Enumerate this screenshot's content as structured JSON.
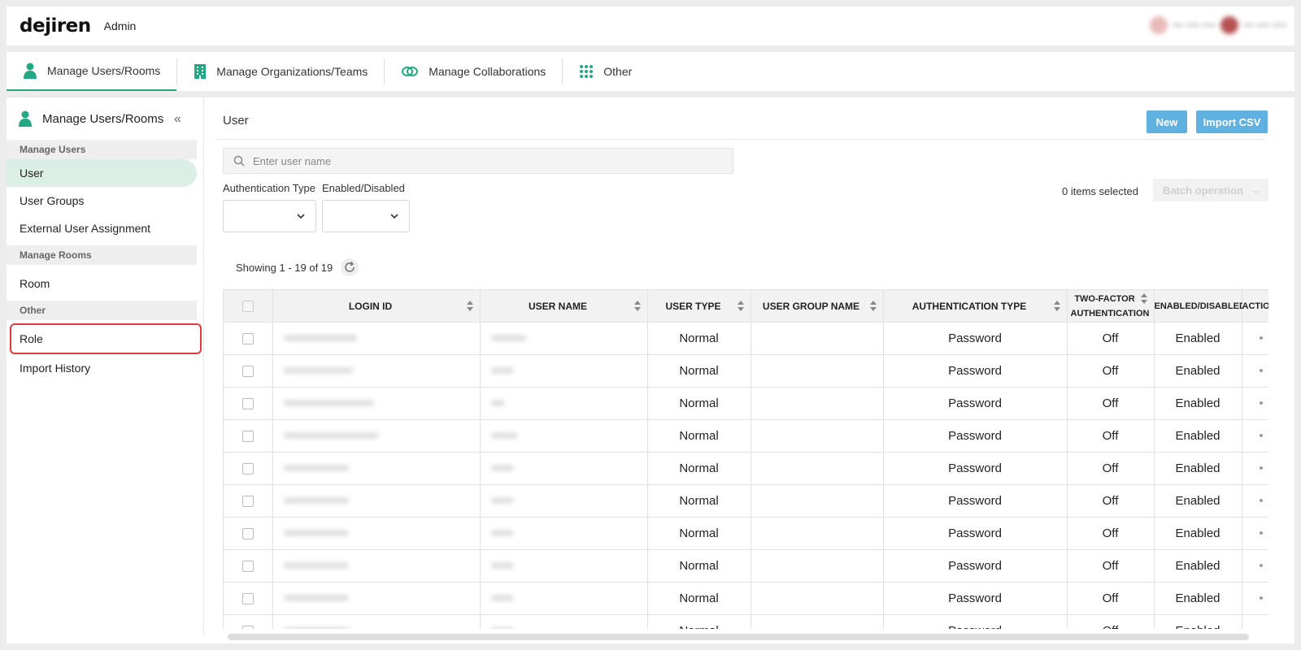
{
  "header": {
    "logo": "dejiren",
    "app_name": "Admin",
    "user_info": "••• •••• ••••"
  },
  "nav": {
    "tabs": [
      {
        "label": "Manage Users/Rooms",
        "icon": "person-icon",
        "active": true
      },
      {
        "label": "Manage Organizations/Teams",
        "icon": "building-icon",
        "active": false
      },
      {
        "label": "Manage Collaborations",
        "icon": "link-icon",
        "active": false
      },
      {
        "label": "Other",
        "icon": "grid-icon",
        "active": false
      }
    ]
  },
  "sidebar": {
    "title": "Manage Users/Rooms",
    "collapse_icon": "«",
    "sections": [
      {
        "label": "Manage Users",
        "items": [
          "User",
          "User Groups",
          "External User Assignment"
        ]
      },
      {
        "label": "Manage Rooms",
        "items": [
          "Room"
        ]
      },
      {
        "label": "Other",
        "items": [
          "Role",
          "Import History"
        ]
      }
    ],
    "active_item": "User",
    "highlighted_item": "Role"
  },
  "main": {
    "title": "User",
    "new_button": "New",
    "import_button": "Import CSV",
    "search_placeholder": "Enter user name",
    "filters": {
      "auth_type_label": "Authentication Type",
      "enabled_label": "Enabled/Disabled"
    },
    "selected_count": "0 items selected",
    "batch_button": "Batch operation",
    "showing": "Showing 1 - 19 of 19"
  },
  "table": {
    "columns": [
      "LOGIN ID",
      "USER NAME",
      "USER TYPE",
      "USER GROUP NAME",
      "AUTHENTICATION TYPE",
      "TWO-FACTOR AUTHENTICATION",
      "ENABLED/DISABLED",
      "ACTIO"
    ],
    "rows": [
      {
        "login_id": "•••••••••••••••••",
        "user_name": "••••••••",
        "user_type": "Normal",
        "group": "",
        "auth": "Password",
        "two_factor": "Off",
        "enabled": "Enabled",
        "action": "•"
      },
      {
        "login_id": "••••••••••••••••",
        "user_name": "•••••",
        "user_type": "Normal",
        "group": "",
        "auth": "Password",
        "two_factor": "Off",
        "enabled": "Enabled",
        "action": "•"
      },
      {
        "login_id": "•••••••••••••••••••••",
        "user_name": "•••",
        "user_type": "Normal",
        "group": "",
        "auth": "Password",
        "two_factor": "Off",
        "enabled": "Enabled",
        "action": "•"
      },
      {
        "login_id": "••••••••••••••••••••••",
        "user_name": "••••••",
        "user_type": "Normal",
        "group": "",
        "auth": "Password",
        "two_factor": "Off",
        "enabled": "Enabled",
        "action": "•"
      },
      {
        "login_id": "•••••••••••••••",
        "user_name": "•••••",
        "user_type": "Normal",
        "group": "",
        "auth": "Password",
        "two_factor": "Off",
        "enabled": "Enabled",
        "action": "•"
      },
      {
        "login_id": "•••••••••••••••",
        "user_name": "•••••",
        "user_type": "Normal",
        "group": "",
        "auth": "Password",
        "two_factor": "Off",
        "enabled": "Enabled",
        "action": "•"
      },
      {
        "login_id": "•••••••••••••••",
        "user_name": "•••••",
        "user_type": "Normal",
        "group": "",
        "auth": "Password",
        "two_factor": "Off",
        "enabled": "Enabled",
        "action": "•"
      },
      {
        "login_id": "•••••••••••••••",
        "user_name": "•••••",
        "user_type": "Normal",
        "group": "",
        "auth": "Password",
        "two_factor": "Off",
        "enabled": "Enabled",
        "action": "•"
      },
      {
        "login_id": "•••••••••••••••",
        "user_name": "•••••",
        "user_type": "Normal",
        "group": "",
        "auth": "Password",
        "two_factor": "Off",
        "enabled": "Enabled",
        "action": "•"
      },
      {
        "login_id": "•••••••••••••••",
        "user_name": "•••••",
        "user_type": "Normal",
        "group": "",
        "auth": "Password",
        "two_factor": "Off",
        "enabled": "Enabled",
        "action": "•"
      }
    ]
  },
  "colors": {
    "accent": "#22a882",
    "button": "#5fb1df",
    "highlight_border": "#e03a3a",
    "active_item_bg": "#dcefe6"
  }
}
